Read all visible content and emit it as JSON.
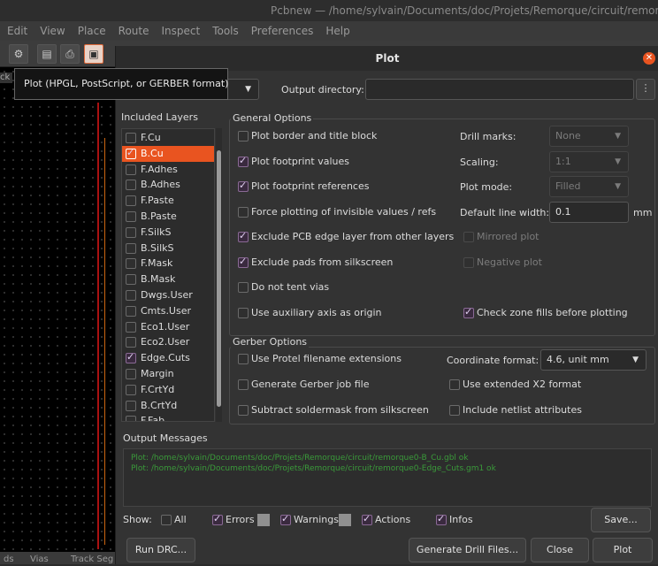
{
  "main_window": {
    "title": "Pcbnew — /home/sylvain/Documents/doc/Projets/Remorque/circuit/remorque0",
    "menu": [
      "Edit",
      "View",
      "Place",
      "Route",
      "Inspect",
      "Tools",
      "Preferences",
      "Help"
    ],
    "side_label": "ck",
    "status": [
      "ds",
      "Vias",
      "Track Seg"
    ]
  },
  "tooltip": "Plot (HPGL, PostScript, or GERBER format)",
  "dialog": {
    "title": "Plot",
    "close_icon": "close-icon",
    "output_directory_label": "Output directory:",
    "output_directory_value": "",
    "layers": {
      "title": "Included Layers",
      "items": [
        {
          "name": "F.Cu",
          "checked": false
        },
        {
          "name": "B.Cu",
          "checked": true,
          "selected": true
        },
        {
          "name": "F.Adhes",
          "checked": false
        },
        {
          "name": "B.Adhes",
          "checked": false
        },
        {
          "name": "F.Paste",
          "checked": false
        },
        {
          "name": "B.Paste",
          "checked": false
        },
        {
          "name": "F.SilkS",
          "checked": false
        },
        {
          "name": "B.SilkS",
          "checked": false
        },
        {
          "name": "F.Mask",
          "checked": false
        },
        {
          "name": "B.Mask",
          "checked": false
        },
        {
          "name": "Dwgs.User",
          "checked": false
        },
        {
          "name": "Cmts.User",
          "checked": false
        },
        {
          "name": "Eco1.User",
          "checked": false
        },
        {
          "name": "Eco2.User",
          "checked": false
        },
        {
          "name": "Edge.Cuts",
          "checked": true
        },
        {
          "name": "Margin",
          "checked": false
        },
        {
          "name": "F.CrtYd",
          "checked": false
        },
        {
          "name": "B.CrtYd",
          "checked": false
        },
        {
          "name": "F.Fab",
          "checked": false
        }
      ]
    },
    "general": {
      "title": "General Options",
      "options": [
        {
          "label": "Plot border and title block",
          "checked": false
        },
        {
          "label": "Plot footprint values",
          "checked": true
        },
        {
          "label": "Plot footprint references",
          "checked": true
        },
        {
          "label": "Force plotting of invisible values / refs",
          "checked": false
        },
        {
          "label": "Exclude PCB edge layer from other layers",
          "checked": true
        },
        {
          "label": "Exclude pads from silkscreen",
          "checked": true
        },
        {
          "label": "Do not tent vias",
          "checked": false
        },
        {
          "label": "Use auxiliary axis as origin",
          "checked": false
        }
      ],
      "drill_marks_label": "Drill marks:",
      "drill_marks_value": "None",
      "scaling_label": "Scaling:",
      "scaling_value": "1:1",
      "plot_mode_label": "Plot mode:",
      "plot_mode_value": "Filled",
      "line_width_label": "Default line width:",
      "line_width_value": "0.1",
      "line_width_unit": "mm",
      "mirrored_label": "Mirrored plot",
      "negative_label": "Negative plot",
      "check_zone_label": "Check zone fills before plotting"
    },
    "gerber": {
      "title": "Gerber Options",
      "protel": "Use Protel filename extensions",
      "job_file": "Generate Gerber job file",
      "subtract": "Subtract soldermask from silkscreen",
      "coord_label": "Coordinate format:",
      "coord_value": "4.6, unit mm",
      "x2": "Use extended X2 format",
      "netlist": "Include netlist attributes"
    },
    "messages": {
      "title": "Output Messages",
      "lines": [
        "Plot: /home/sylvain/Documents/doc/Projets/Remorque/circuit/remorque0-B_Cu.gbl   ok",
        "Plot: /home/sylvain/Documents/doc/Projets/Remorque/circuit/remorque0-Edge_Cuts.gm1   ok"
      ]
    },
    "show": {
      "label": "Show:",
      "all": "All",
      "errors": "Errors",
      "warnings": "Warnings",
      "actions": "Actions",
      "infos": "Infos"
    },
    "buttons": {
      "save": "Save...",
      "run_drc": "Run DRC...",
      "drill": "Generate Drill Files...",
      "close": "Close",
      "plot": "Plot"
    }
  }
}
